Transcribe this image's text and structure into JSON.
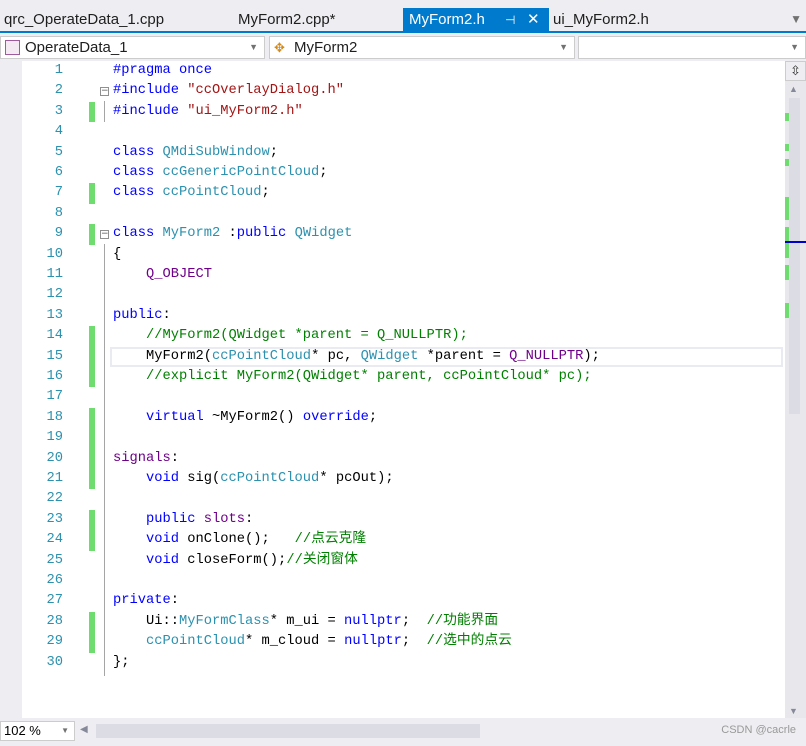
{
  "tabs": [
    {
      "label": "qrc_OperateData_1.cpp",
      "active": false
    },
    {
      "label": "MyForm2.cpp*",
      "active": false
    },
    {
      "label": "MyForm2.h",
      "active": true
    },
    {
      "label": "ui_MyForm2.h",
      "active": false
    }
  ],
  "tab_icons": {
    "pin": "pin-icon",
    "close": "close-icon",
    "menu": "dropdown-icon"
  },
  "nav": {
    "project": "OperateData_1",
    "scope": "MyForm2",
    "member": ""
  },
  "zoom_level": "102 %",
  "watermark": "CSDN @cacrle",
  "colors": {
    "accent": "#007acc",
    "keyword": "#0000ff",
    "type": "#2b91af",
    "string": "#a31515",
    "comment": "#008000",
    "macro": "#6f008a",
    "change_bar": "#6fdc6f"
  },
  "current_line": 15,
  "changed_lines": [
    3,
    7,
    9,
    14,
    15,
    16,
    18,
    19,
    20,
    21,
    23,
    24,
    28,
    29
  ],
  "lines": [
    [
      [
        "kw",
        "#pragma once"
      ]
    ],
    [
      [
        "kw",
        "#include "
      ],
      [
        "str",
        "\"ccOverlayDialog.h\""
      ]
    ],
    [
      [
        "kw",
        "#include "
      ],
      [
        "str",
        "\"ui_MyForm2.h\""
      ]
    ],
    [],
    [
      [
        "kw",
        "class "
      ],
      [
        "ty",
        "QMdiSubWindow"
      ],
      [
        "pl",
        ";"
      ]
    ],
    [
      [
        "kw",
        "class "
      ],
      [
        "ty",
        "ccGenericPointCloud"
      ],
      [
        "pl",
        ";"
      ]
    ],
    [
      [
        "kw",
        "class "
      ],
      [
        "ty",
        "ccPointCloud"
      ],
      [
        "pl",
        ";"
      ]
    ],
    [],
    [
      [
        "kw",
        "class "
      ],
      [
        "ty",
        "MyForm2"
      ],
      [
        "pl",
        " :"
      ],
      [
        "kw",
        "public "
      ],
      [
        "ty",
        "QWidget"
      ]
    ],
    [
      [
        "pl",
        "{"
      ]
    ],
    [
      [
        "pl",
        "    "
      ],
      [
        "mac",
        "Q_OBJECT"
      ]
    ],
    [],
    [
      [
        "kw",
        "public"
      ],
      [
        "pl",
        ":"
      ]
    ],
    [
      [
        "pl",
        "    "
      ],
      [
        "cm",
        "//MyForm2(QWidget *parent = Q_NULLPTR);"
      ]
    ],
    [
      [
        "pl",
        "    MyForm2("
      ],
      [
        "ty",
        "ccPointCloud"
      ],
      [
        "pl",
        "* pc, "
      ],
      [
        "ty",
        "QWidget"
      ],
      [
        "pl",
        " *parent = "
      ],
      [
        "mac",
        "Q_NULLPTR"
      ],
      [
        "pl",
        ");"
      ]
    ],
    [
      [
        "pl",
        "    "
      ],
      [
        "cm",
        "//explicit MyForm2(QWidget* parent, ccPointCloud* pc);"
      ]
    ],
    [],
    [
      [
        "pl",
        "    "
      ],
      [
        "kw",
        "virtual"
      ],
      [
        "pl",
        " ~MyForm2() "
      ],
      [
        "kw",
        "override"
      ],
      [
        "pl",
        ";"
      ]
    ],
    [],
    [
      [
        "mac",
        "signals"
      ],
      [
        "pl",
        ":"
      ]
    ],
    [
      [
        "pl",
        "    "
      ],
      [
        "kw",
        "void"
      ],
      [
        "pl",
        " sig("
      ],
      [
        "ty",
        "ccPointCloud"
      ],
      [
        "pl",
        "* pcOut);"
      ]
    ],
    [],
    [
      [
        "pl",
        "    "
      ],
      [
        "kw",
        "public "
      ],
      [
        "mac",
        "slots"
      ],
      [
        "pl",
        ":"
      ]
    ],
    [
      [
        "pl",
        "    "
      ],
      [
        "kw",
        "void"
      ],
      [
        "pl",
        " onClone();   "
      ],
      [
        "cm",
        "//点云克隆"
      ]
    ],
    [
      [
        "pl",
        "    "
      ],
      [
        "kw",
        "void"
      ],
      [
        "pl",
        " closeForm();"
      ],
      [
        "cm",
        "//关闭窗体"
      ]
    ],
    [],
    [
      [
        "kw",
        "private"
      ],
      [
        "pl",
        ":"
      ]
    ],
    [
      [
        "pl",
        "    Ui::"
      ],
      [
        "ty",
        "MyFormClass"
      ],
      [
        "pl",
        "* m_ui = "
      ],
      [
        "kw",
        "nullptr"
      ],
      [
        "pl",
        ";  "
      ],
      [
        "cm",
        "//功能界面"
      ]
    ],
    [
      [
        "pl",
        "    "
      ],
      [
        "ty",
        "ccPointCloud"
      ],
      [
        "pl",
        "* m_cloud = "
      ],
      [
        "kw",
        "nullptr"
      ],
      [
        "pl",
        ";  "
      ],
      [
        "cm",
        "//选中的点云"
      ]
    ],
    [
      [
        "pl",
        "};"
      ]
    ]
  ]
}
